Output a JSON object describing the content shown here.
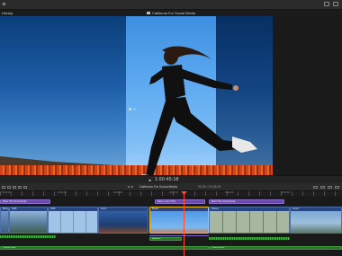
{
  "header": {
    "clip_name": "Library",
    "project_title": "California For Social Media"
  },
  "viewer": {
    "timecode": "1:00:45:18",
    "play_symbol": "►"
  },
  "timeline_toolbar": {
    "nav_symbol": "◄ ►",
    "title": "California For Social Media",
    "duration": "00:30 / 01:06:15"
  },
  "ruler": {
    "ticks": [
      "00:00:00",
      "00:00:10",
      "00:00:20",
      "00:00:30",
      "00:00:40",
      "00:00:50"
    ]
  },
  "timeline": {
    "title_clips": [
      {
        "label": "Basic Title Social Media"
      },
      {
        "label": "Basic Lower Third"
      },
      {
        "label": "Basic Title Social Media"
      }
    ],
    "video_clips": [
      {
        "label": "Bixby"
      },
      {
        "label": "Cliffs"
      },
      {
        "label": "Cliffs"
      },
      {
        "label": "Jump"
      },
      {
        "label": "Beach"
      },
      {
        "label": "Horses"
      },
      {
        "label": "Coast"
      }
    ],
    "audio_clips": [
      {
        "label": "Ambience"
      },
      {
        "label": "Cheerful Music"
      },
      {
        "label": "Cheerful Music"
      }
    ]
  },
  "colors": {
    "title_clip": "#6a4aa8",
    "video_clip": "#2e4f82",
    "audio_clip": "#2e6f2e",
    "playhead": "#ff4a2e",
    "selection": "#f2c022"
  }
}
